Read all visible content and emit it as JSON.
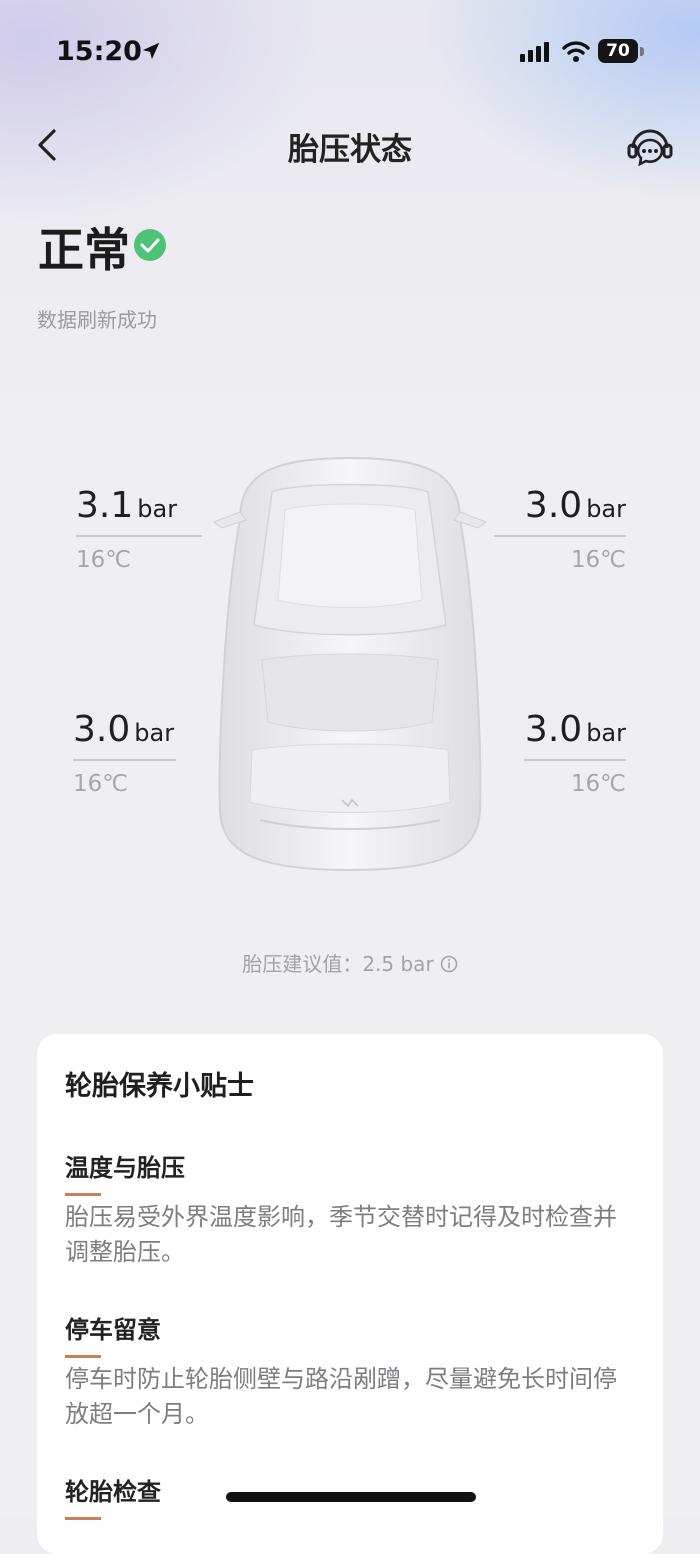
{
  "status_bar": {
    "time": "15:20",
    "battery": "70"
  },
  "header": {
    "title": "胎压状态"
  },
  "summary": {
    "status": "正常",
    "refresh_text": "数据刷新成功"
  },
  "tires": {
    "front_left": {
      "pressure": "3.1",
      "unit": "bar",
      "temp": "16℃"
    },
    "front_right": {
      "pressure": "3.0",
      "unit": "bar",
      "temp": "16℃"
    },
    "rear_left": {
      "pressure": "3.0",
      "unit": "bar",
      "temp": "16℃"
    },
    "rear_right": {
      "pressure": "3.0",
      "unit": "bar",
      "temp": "16℃"
    }
  },
  "advice": "胎压建议值：2.5 bar",
  "tips": {
    "title": "轮胎保养小贴士",
    "items": [
      {
        "heading": "温度与胎压",
        "body": "胎压易受外界温度影响，季节交替时记得及时检查并调整胎压。"
      },
      {
        "heading": "停车留意",
        "body": "停车时防止轮胎侧壁与路沿剐蹭，尽量避免长时间停放超一个月。"
      },
      {
        "heading": "轮胎检查",
        "body": ""
      }
    ]
  },
  "colors": {
    "ok_green": "#4fc27a",
    "accent_bar": "#c9805f"
  },
  "icons": [
    "location-arrow-icon",
    "signal-icon",
    "wifi-icon",
    "back-icon",
    "customer-service-icon",
    "check-circle-icon",
    "info-icon"
  ]
}
